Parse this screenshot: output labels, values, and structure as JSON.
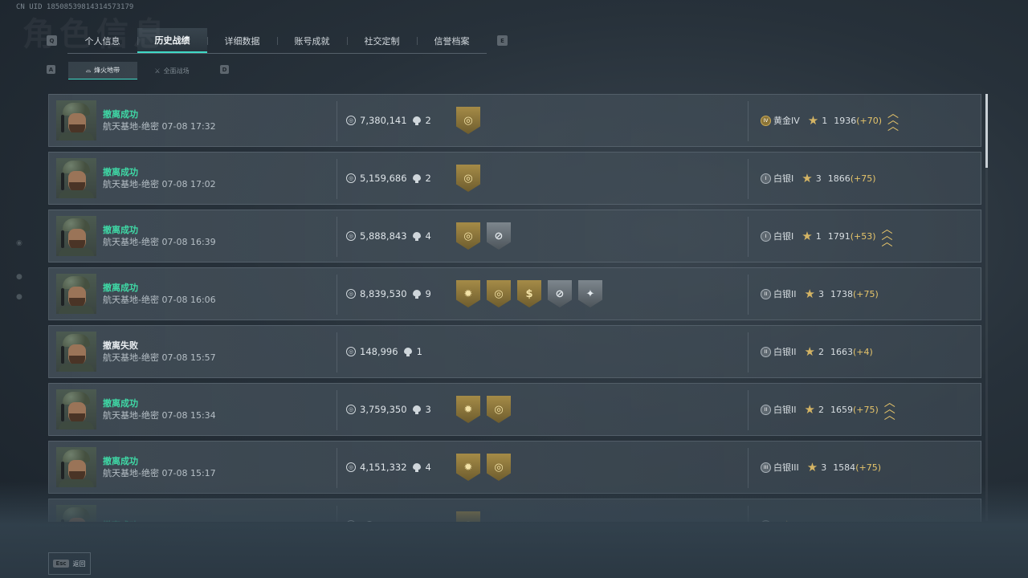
{
  "uid": "CN UID 18508539814314573179",
  "background_title": "角色信息",
  "tabs": {
    "prev_key": "Q",
    "next_key": "E",
    "items": [
      {
        "label": "个人信息"
      },
      {
        "label": "历史战绩",
        "active": true
      },
      {
        "label": "详细数据"
      },
      {
        "label": "账号成就"
      },
      {
        "label": "社交定制"
      },
      {
        "label": "信誉档案"
      }
    ]
  },
  "subtabs": {
    "prev_key": "A",
    "next_key": "D",
    "items": [
      {
        "label": "烽火地带",
        "active": true
      },
      {
        "label": "全面战场"
      }
    ]
  },
  "records": [
    {
      "status": "撤离成功",
      "success": true,
      "map": "航天基地-绝密",
      "time": "07-08 17:32",
      "value": "7,380,141",
      "kills": "2",
      "badges": [
        {
          "type": "gold",
          "icon": "◎"
        }
      ],
      "rank": "黄金IV",
      "rank_tier": "gold",
      "rank_icon": "IV",
      "stars": "1",
      "score": "1936",
      "delta": "(+70)",
      "promotion": true
    },
    {
      "status": "撤离成功",
      "success": true,
      "map": "航天基地-绝密",
      "time": "07-08 17:02",
      "value": "5,159,686",
      "kills": "2",
      "badges": [
        {
          "type": "gold",
          "icon": "◎"
        }
      ],
      "rank": "白银I",
      "rank_tier": "silver",
      "rank_icon": "I",
      "stars": "3",
      "score": "1866",
      "delta": "(+75)",
      "promotion": false
    },
    {
      "status": "撤离成功",
      "success": true,
      "map": "航天基地-绝密",
      "time": "07-08 16:39",
      "value": "5,888,843",
      "kills": "4",
      "badges": [
        {
          "type": "gold",
          "icon": "◎"
        },
        {
          "type": "silver",
          "icon": "⊘"
        }
      ],
      "rank": "白银I",
      "rank_tier": "silver",
      "rank_icon": "I",
      "stars": "1",
      "score": "1791",
      "delta": "(+53)",
      "promotion": true
    },
    {
      "status": "撤离成功",
      "success": true,
      "map": "航天基地-绝密",
      "time": "07-08 16:06",
      "value": "8,839,530",
      "kills": "9",
      "badges": [
        {
          "type": "gold",
          "icon": "✹"
        },
        {
          "type": "gold",
          "icon": "◎"
        },
        {
          "type": "gold",
          "icon": "$"
        },
        {
          "type": "silver",
          "icon": "⊘"
        },
        {
          "type": "silver",
          "icon": "✦"
        }
      ],
      "rank": "白银II",
      "rank_tier": "silver",
      "rank_icon": "II",
      "stars": "3",
      "score": "1738",
      "delta": "(+75)",
      "promotion": false
    },
    {
      "status": "撤离失败",
      "success": false,
      "map": "航天基地-绝密",
      "time": "07-08 15:57",
      "value": "148,996",
      "kills": "1",
      "badges": [],
      "rank": "白银II",
      "rank_tier": "silver",
      "rank_icon": "II",
      "stars": "2",
      "score": "1663",
      "delta": "(+4)",
      "promotion": false
    },
    {
      "status": "撤离成功",
      "success": true,
      "map": "航天基地-绝密",
      "time": "07-08 15:34",
      "value": "3,759,350",
      "kills": "3",
      "badges": [
        {
          "type": "gold",
          "icon": "✹"
        },
        {
          "type": "gold",
          "icon": "◎"
        }
      ],
      "rank": "白银II",
      "rank_tier": "silver",
      "rank_icon": "II",
      "stars": "2",
      "score": "1659",
      "delta": "(+75)",
      "promotion": true
    },
    {
      "status": "撤离成功",
      "success": true,
      "map": "航天基地-绝密",
      "time": "07-08 15:17",
      "value": "4,151,332",
      "kills": "4",
      "badges": [
        {
          "type": "gold",
          "icon": "✹"
        },
        {
          "type": "gold",
          "icon": "◎"
        }
      ],
      "rank": "白银III",
      "rank_tier": "silver",
      "rank_icon": "III",
      "stars": "3",
      "score": "1584",
      "delta": "(+75)",
      "promotion": false
    },
    {
      "status": "撤离成功",
      "success": true,
      "map": "",
      "time": "",
      "value": "",
      "kills": "",
      "badges": [
        {
          "type": "gold",
          "icon": "◎"
        }
      ],
      "rank": "",
      "rank_tier": "silver",
      "rank_icon": "",
      "stars": "",
      "score": "",
      "delta": "",
      "promotion": false
    }
  ],
  "footer": {
    "esc_key": "Esc",
    "back_label": "返回"
  },
  "colors": {
    "accent": "#3fd9c6",
    "success": "#3fd9a6",
    "gold": "#e6c46a"
  }
}
